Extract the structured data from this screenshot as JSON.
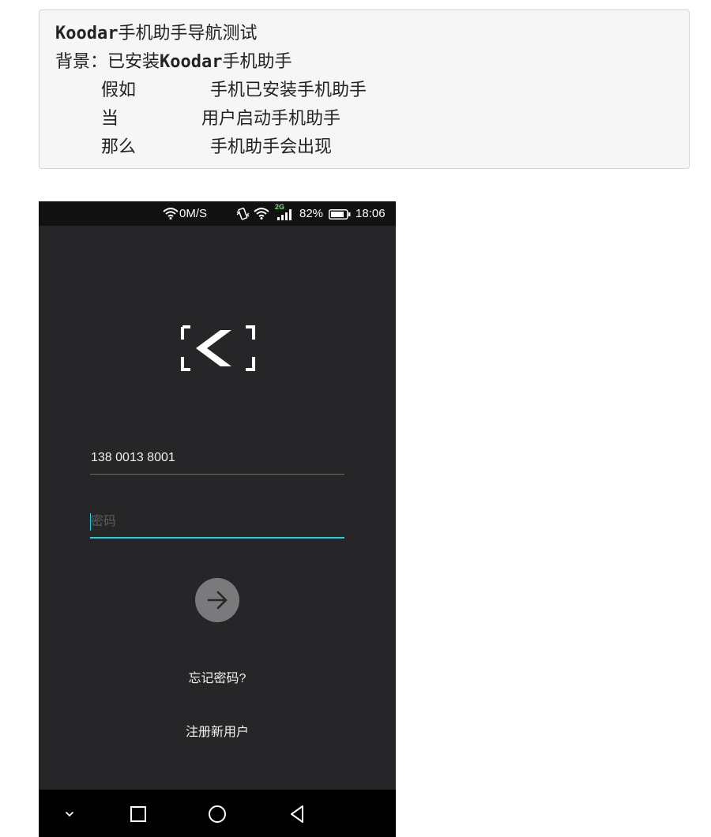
{
  "scenario": {
    "feature_prefix": "Koodar",
    "feature_rest": "手机助手导航测试",
    "background_label": "背景：",
    "background_rest": "已安装",
    "background_brand": "Koodar",
    "background_tail": "手机助手",
    "steps": [
      {
        "keyword": "假如",
        "text": "手机已安装手机助手"
      },
      {
        "keyword": "当",
        "text": "用户启动手机助手"
      },
      {
        "keyword": "那么",
        "text": "手机助手会出现"
      }
    ]
  },
  "phone": {
    "status_bar": {
      "net_speed": "0M/S",
      "network_type": "2G",
      "battery": "82%",
      "time": "18:06",
      "icons": [
        "wifi-icon",
        "vibrate-icon",
        "wifi-icon",
        "signal-icon",
        "battery-icon"
      ]
    },
    "login": {
      "phone_value": "138 0013 8001",
      "password_placeholder": "密码",
      "submit_icon": "arrow-right-icon",
      "forgot_password": "忘记密码?",
      "register": "注册新用户"
    },
    "nav_bar": {
      "icons": [
        "chevron-down-icon",
        "recent-apps-icon",
        "home-icon",
        "back-icon"
      ]
    },
    "colors": {
      "background": "#262628",
      "accent": "#20d5e0",
      "button": "#7a7a7c"
    }
  }
}
